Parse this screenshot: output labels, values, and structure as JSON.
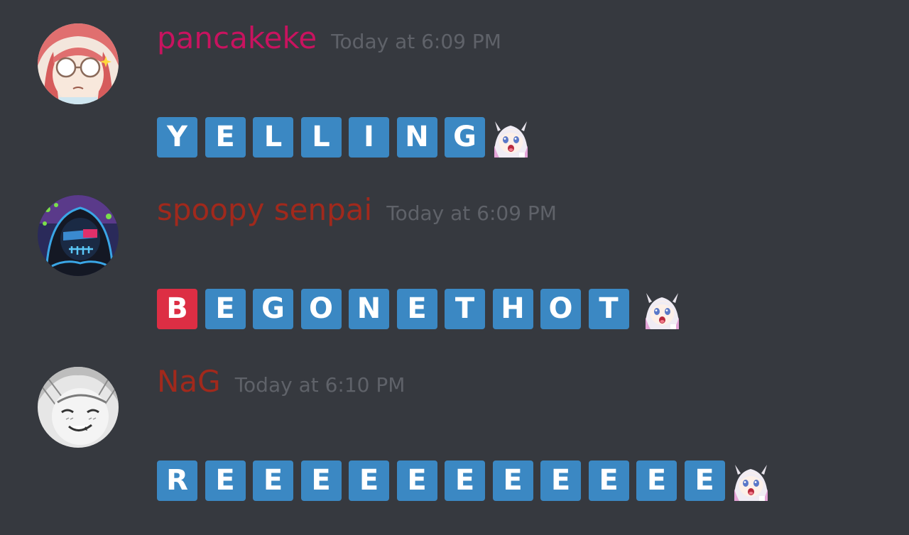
{
  "messages": [
    {
      "username": "pancakeke",
      "username_color": "#c8135f",
      "timestamp": "Today at 6:09 PM",
      "avatar_icon": "avatar-glasses-girl",
      "tiles": [
        {
          "letter": "Y",
          "color": "#3b88c3"
        },
        {
          "letter": "E",
          "color": "#3b88c3"
        },
        {
          "letter": "L",
          "color": "#3b88c3"
        },
        {
          "letter": "L",
          "color": "#3b88c3"
        },
        {
          "letter": "I",
          "color": "#3b88c3"
        },
        {
          "letter": "N",
          "color": "#3b88c3"
        },
        {
          "letter": "G",
          "color": "#3b88c3"
        }
      ],
      "trailing_emoji": "kanna-shocked-emoji"
    },
    {
      "username": "spoopy senpai",
      "username_color": "#a1291c",
      "timestamp": "Today at 6:09 PM",
      "avatar_icon": "avatar-skeleton-hood",
      "tiles": [
        {
          "letter": "B",
          "color": "#dd2e44"
        },
        {
          "letter": "E",
          "color": "#3b88c3"
        },
        {
          "letter": "G",
          "color": "#3b88c3"
        },
        {
          "letter": "O",
          "color": "#3b88c3"
        },
        {
          "letter": "N",
          "color": "#3b88c3"
        },
        {
          "letter": "E",
          "color": "#3b88c3"
        },
        {
          "letter": "T",
          "color": "#3b88c3"
        },
        {
          "letter": "H",
          "color": "#3b88c3"
        },
        {
          "letter": "O",
          "color": "#3b88c3"
        },
        {
          "letter": "T",
          "color": "#3b88c3"
        }
      ],
      "trailing_emoji": "kanna-shocked-emoji"
    },
    {
      "username": "NaG",
      "username_color": "#a1291c",
      "timestamp": "Today at 6:10 PM",
      "avatar_icon": "avatar-manga-face",
      "tiles": [
        {
          "letter": "R",
          "color": "#3b88c3"
        },
        {
          "letter": "E",
          "color": "#3b88c3"
        },
        {
          "letter": "E",
          "color": "#3b88c3"
        },
        {
          "letter": "E",
          "color": "#3b88c3"
        },
        {
          "letter": "E",
          "color": "#3b88c3"
        },
        {
          "letter": "E",
          "color": "#3b88c3"
        },
        {
          "letter": "E",
          "color": "#3b88c3"
        },
        {
          "letter": "E",
          "color": "#3b88c3"
        },
        {
          "letter": "E",
          "color": "#3b88c3"
        },
        {
          "letter": "E",
          "color": "#3b88c3"
        },
        {
          "letter": "E",
          "color": "#3b88c3"
        },
        {
          "letter": "E",
          "color": "#3b88c3"
        }
      ],
      "trailing_emoji": "kanna-shocked-emoji"
    }
  ],
  "colors": {
    "background": "#36393f",
    "timestamp": "#5f6269",
    "tile_blue": "#3b88c3",
    "tile_red": "#dd2e44"
  }
}
